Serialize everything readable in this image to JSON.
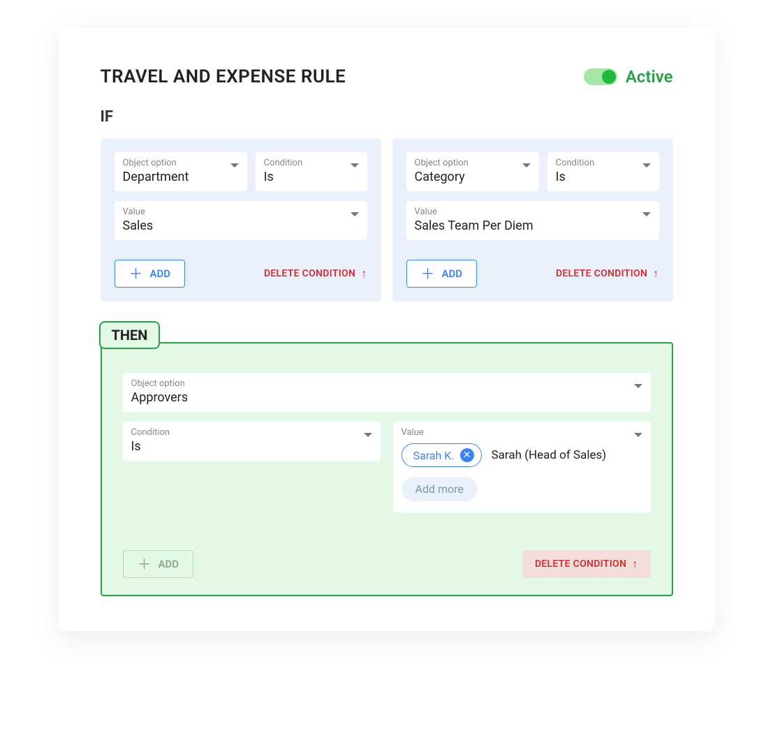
{
  "header": {
    "title": "TRAVEL AND EXPENSE RULE",
    "status_label": "Active"
  },
  "labels": {
    "if": "IF",
    "then": "THEN",
    "object_option": "Object option",
    "condition": "Condition",
    "value": "Value",
    "add": "ADD",
    "delete_condition": "DELETE CONDITION",
    "add_more": "Add more"
  },
  "if_conditions": [
    {
      "object_option": "Department",
      "condition": "Is",
      "value": "Sales"
    },
    {
      "object_option": "Category",
      "condition": "Is",
      "value": "Sales Team Per Diem"
    }
  ],
  "then": {
    "object_option": "Approvers",
    "condition": "Is",
    "value_chip": "Sarah K.",
    "value_desc": "Sarah (Head of Sales)"
  }
}
